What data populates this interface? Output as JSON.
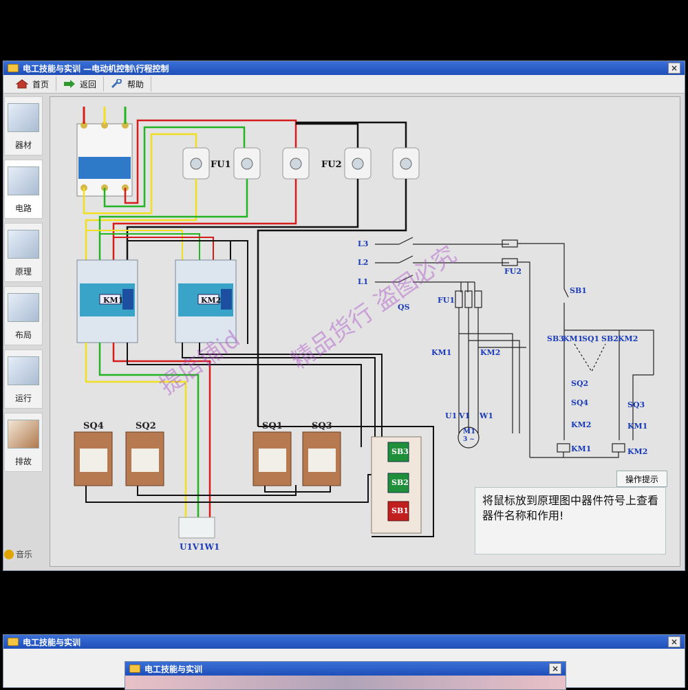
{
  "top_window": {
    "title": "电工技能与实训 —电动机控制\\行程控制",
    "close": "×",
    "toolbar": {
      "home": "首页",
      "back": "返回",
      "help": "帮助"
    },
    "sidebar": [
      {
        "label": "器材",
        "icon": "components-icon"
      },
      {
        "label": "电路",
        "icon": "circuit-icon"
      },
      {
        "label": "原理",
        "icon": "schematic-icon"
      },
      {
        "label": "布局",
        "icon": "layout-icon"
      },
      {
        "label": "运行",
        "icon": "run-icon"
      },
      {
        "label": "排故",
        "icon": "troubleshoot-icon"
      }
    ],
    "music": "音乐",
    "wiring": {
      "fuse1": "FU1",
      "fuse2": "FU2",
      "contactor1": "KM1",
      "contactor2": "KM2",
      "limit_switches": [
        "SQ4",
        "SQ2",
        "SQ1",
        "SQ3"
      ],
      "buttons": [
        "SB3",
        "SB2",
        "SB1"
      ],
      "motor_terminals": "U1V1W1"
    },
    "schematic": {
      "phases": [
        "L3",
        "L2",
        "L1"
      ],
      "qs": "QS",
      "fu1": "FU1",
      "fu2": "FU2",
      "km1": "KM1",
      "km2": "KM2",
      "motor": "M1",
      "motor_sub": "3 ~",
      "u1": "U1",
      "v1": "V1",
      "w1": "W1",
      "sb1": "SB1",
      "sb3": "SB3",
      "sq1": "SQ1",
      "sb2": "SB2",
      "sq2": "SQ2",
      "sq4": "SQ4",
      "sq3": "SQ3",
      "coil_km1": "KM1",
      "coil_km2": "KM2"
    },
    "hint_tab": "操作提示",
    "hint_text": "将鼠标放到原理图中器件符号上查看器件名称和作用!",
    "watermark1": "提店铺id",
    "watermark2": "精品货行 盗图必究"
  },
  "bottom_window": {
    "title": "电工技能与实训",
    "close": "×",
    "dialog_title": "电工技能与实训",
    "dialog_close": "×"
  },
  "colors": {
    "titlebar": "#2a5fcc",
    "wire_red": "#d61b1b",
    "wire_yellow": "#f0e020",
    "wire_green": "#22b422",
    "wire_black": "#111111",
    "label_blue": "#1a3bb8"
  }
}
